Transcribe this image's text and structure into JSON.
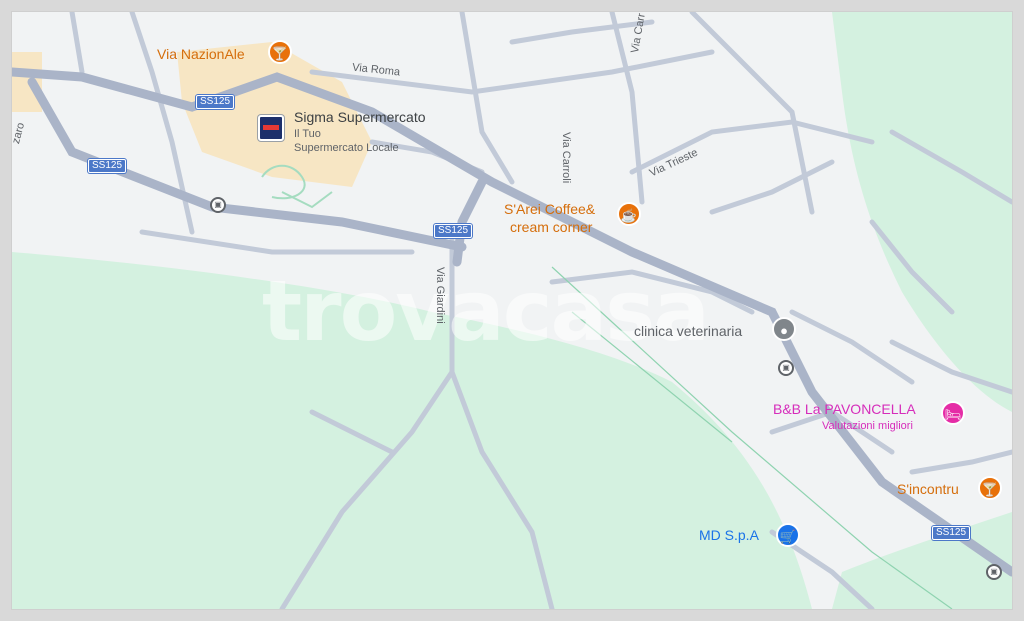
{
  "labels": {
    "via_nazionale": "Via NazionAle",
    "sigma_title": "Sigma Supermercato",
    "sigma_sub1": "Il Tuo",
    "sigma_sub2": "Supermercato Locale",
    "sarei_line1": "S'Arei Coffee&",
    "sarei_line2": "cream corner",
    "clinica": "clinica veterinaria",
    "bnb_title": "B&B La PAVONCELLA",
    "bnb_sub": "Valutazioni migliori",
    "sincontru": "S'incontru",
    "md": "MD S.p.A"
  },
  "streets": {
    "via_roma": "Via Roma",
    "via_carroli": "Via Carroli",
    "via_carroli_top": "Via Carr",
    "via_trieste": "Via Trieste",
    "via_giardini": "Via Giardini",
    "left_edge": "zaro"
  },
  "road_badges": [
    "SS125",
    "SS125",
    "SS125",
    "SS125"
  ],
  "watermark": "trovacasa",
  "icons": {
    "bar": "cocktail-icon",
    "coffee": "coffee-cup-icon",
    "vet": "pet-clinic-icon",
    "hotel": "bed-icon",
    "shop": "shopping-cart-icon",
    "bus": "bus-stop-icon"
  },
  "colors": {
    "land": "#f1f3f4",
    "park": "#d4f1e0",
    "urban": "#f7e6c4",
    "road_main": "#aab4c8",
    "road_minor": "#c2cad8",
    "poi_orange": "#e8710a",
    "poi_pink": "#e52ca6",
    "poi_blue": "#1a73e8"
  }
}
